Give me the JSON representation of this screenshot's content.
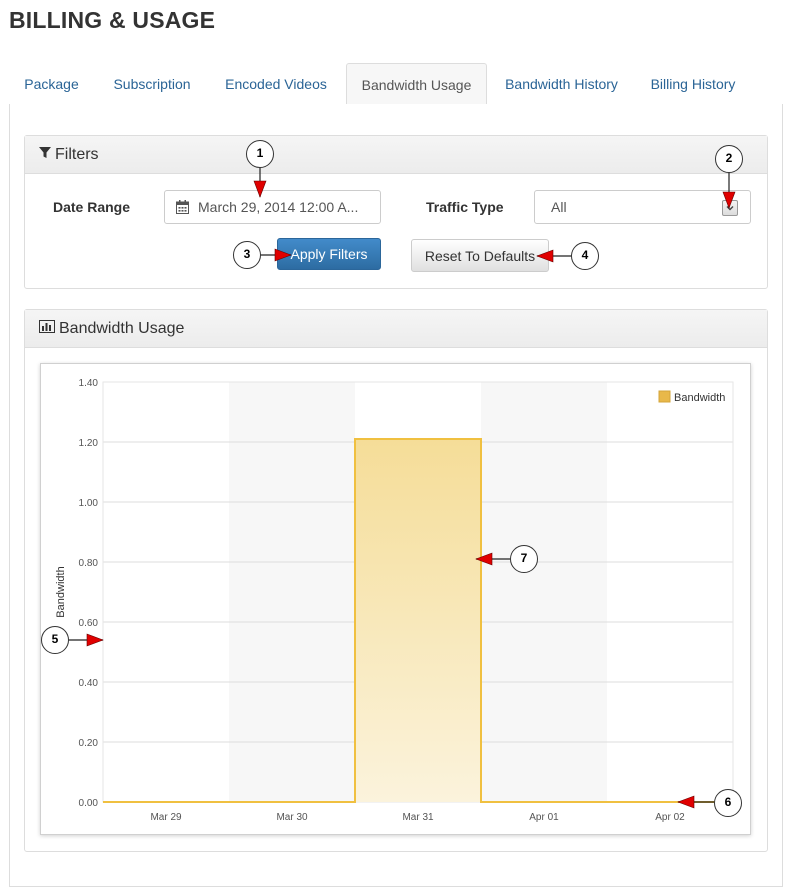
{
  "page": {
    "title": "BILLING & USAGE"
  },
  "tabs": [
    {
      "label": "Package",
      "active": false
    },
    {
      "label": "Subscription",
      "active": false
    },
    {
      "label": "Encoded Videos",
      "active": false
    },
    {
      "label": "Bandwidth Usage",
      "active": true
    },
    {
      "label": "Bandwidth History",
      "active": false
    },
    {
      "label": "Billing History",
      "active": false
    }
  ],
  "filters": {
    "heading": "Filters",
    "date_range_label": "Date Range",
    "date_range_value": "March 29, 2014 12:00 A...",
    "traffic_type_label": "Traffic Type",
    "traffic_type_value": "All",
    "apply_label": "Apply Filters",
    "reset_label": "Reset To Defaults"
  },
  "usage_panel": {
    "heading": "Bandwidth Usage"
  },
  "callouts": [
    "1",
    "2",
    "3",
    "4",
    "5",
    "6",
    "7"
  ],
  "colors": {
    "accent": "#428bca",
    "bar_stroke": "#f0c040",
    "bar_fill_top": "#f5dd98",
    "bar_fill_bottom": "#fbf3dc",
    "marker": "#e8b84a",
    "arrow": "#e00000"
  },
  "chart_data": {
    "type": "area",
    "categories": [
      "Mar 29",
      "Mar 30",
      "Mar 31",
      "Apr 01",
      "Apr 02"
    ],
    "series": [
      {
        "name": "Bandwidth",
        "values": [
          0,
          0,
          1.21,
          0,
          0
        ]
      }
    ],
    "title": "",
    "xlabel": "",
    "ylabel": "Bandwidth",
    "ylim": [
      0,
      1.4
    ],
    "yticks": [
      "0.00",
      "0.20",
      "0.40",
      "0.60",
      "0.80",
      "1.00",
      "1.20",
      "1.40"
    ],
    "grid": true,
    "legend": "top-right"
  }
}
